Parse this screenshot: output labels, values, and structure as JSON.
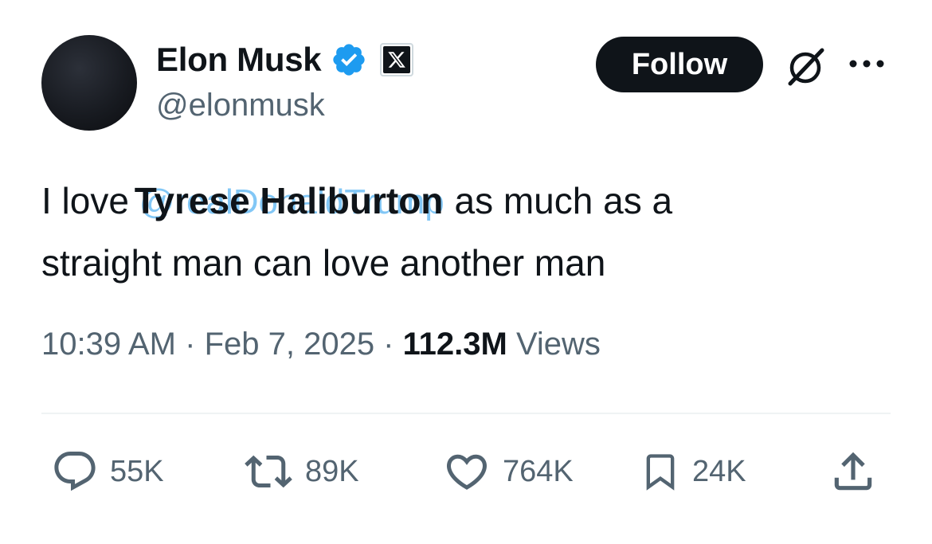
{
  "author": {
    "display_name": "Elon Musk",
    "handle": "@elonmusk",
    "verified_color": "#1d9bf0"
  },
  "header": {
    "follow_label": "Follow",
    "icons": [
      "verified-badge-icon",
      "x-logo-icon",
      "grok-icon",
      "more-icon"
    ]
  },
  "tweet": {
    "text_before": "I love ",
    "mention_underlay": "@realDonaldTrump",
    "overlay_name": "Tyrese Haliburton",
    "text_after_line1": " as much as a",
    "text_line2": "straight man can love another man"
  },
  "meta": {
    "time": "10:39 AM",
    "separator": " · ",
    "date": "Feb 7, 2025",
    "views_count": "112.3M",
    "views_label": "Views"
  },
  "actions": {
    "replies": "55K",
    "reposts": "89K",
    "likes": "764K",
    "bookmarks": "24K"
  },
  "colors": {
    "text": "#0f1419",
    "secondary": "#536471",
    "accent": "#1d9bf0",
    "divider": "#eff3f4"
  }
}
